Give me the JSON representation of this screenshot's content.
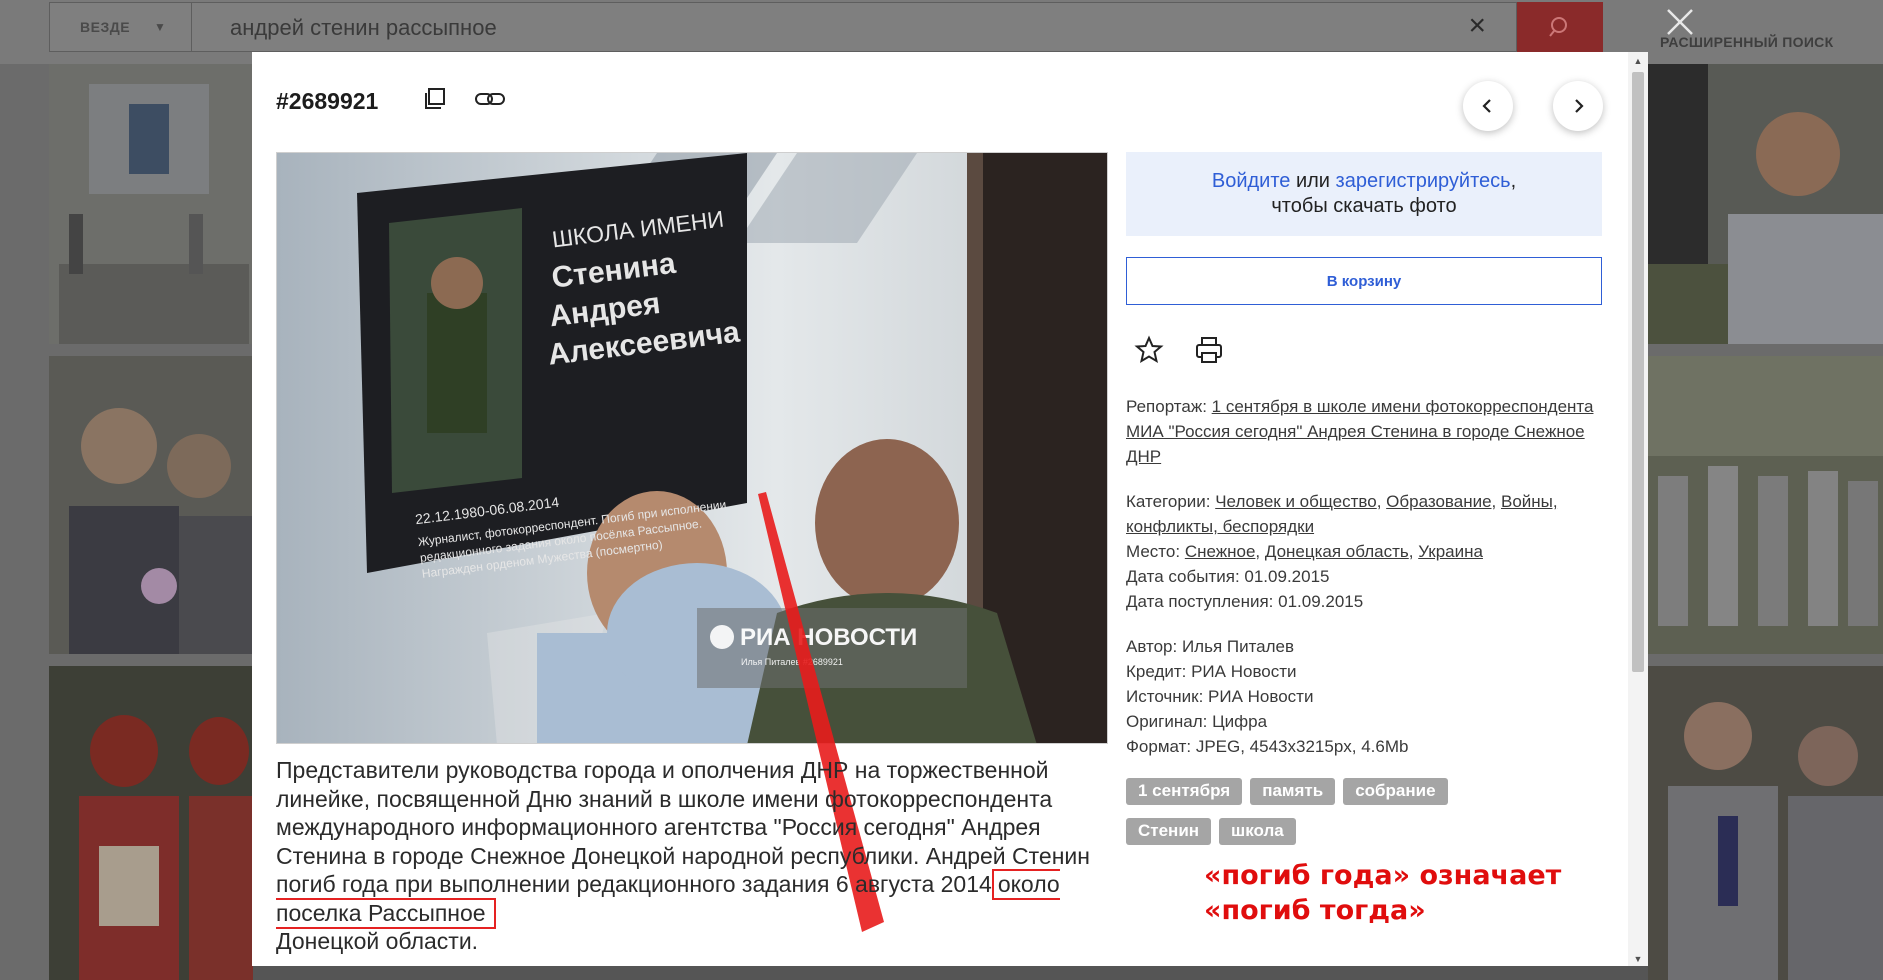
{
  "search": {
    "scope_label": "ВЕЗДЕ",
    "query": "андрей стенин рассыпное",
    "advanced_label": "РАСШИРЕННЫЙ ПОИСК"
  },
  "modal": {
    "photo_id": "#2689921",
    "watermark": {
      "brand": "РИА НОВОСТИ",
      "credit": "Илья Питалев #2689921"
    },
    "plaque": {
      "line1": "ШКОЛА ИМЕНИ",
      "line2": "Стенина",
      "line3": "Андрея",
      "line4": "Алексеевича",
      "dates": "22.12.1980-06.08.2014",
      "text1": "Журналист, фотокорреспондент. Погиб при исполнении",
      "text2": "редакционного задания около посёлка Рассыпное.",
      "text3": "Награжден орденом Мужества (посмертно)"
    },
    "caption_main": "Представители руководства города и ополчения ДНР на торжественной линейке, посвященной Дню знаний в школе имени фотокорреспондента международного информационного агентства \"Россия сегодня\" Андрея Стенина в городе Снежное Донецкой народной республики. Андрей Стенин погиб года при выполнении редакционного задания 6 августа 2014",
    "caption_highlight": "около поселка Рассыпное",
    "caption_end": "Донецкой области.",
    "login": {
      "login_link": "Войдите",
      "or": " или ",
      "register_link": "зарегистрируйтесь",
      "comma": ",",
      "rest": "чтобы скачать фото"
    },
    "cart_label": "В корзину",
    "report_label": "Репортаж: ",
    "report_value": "1 сентября в школе имени фотокорреспондента МИА \"Россия сегодня\" Андрея Стенина в городе Снежное ДНР",
    "categories_label": "Категории: ",
    "categories": [
      "Человек и общество",
      "Образование",
      "Войны, конфликты, беспорядки"
    ],
    "place_label": "Место: ",
    "places": [
      "Снежное",
      "Донецкая область",
      "Украина"
    ],
    "sep": ", ",
    "event_date": "Дата события: 01.09.2015",
    "received_date": "Дата поступления: 01.09.2015",
    "author": "Автор: Илья Питалев",
    "credit": "Кредит: РИА Новости",
    "source": "Источник: РИА Новости",
    "original": "Оригинал: Цифра",
    "format": "Формат: JPEG, 4543x3215px, 4.6Mb",
    "tags": [
      "1 сентября",
      "память",
      "собрание",
      "Стенин",
      "школа"
    ],
    "annotation_line1": "«погиб года» означает",
    "annotation_line2": "«погиб тогда»"
  },
  "colors": {
    "link": "#2f5ed6",
    "annotation": "#e00d0d",
    "tag_bg": "#a5a5a5"
  }
}
